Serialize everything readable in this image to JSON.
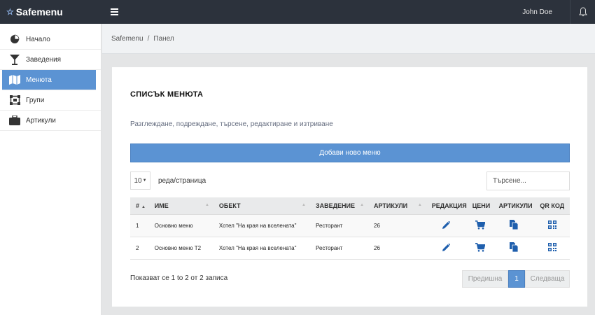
{
  "topbar": {
    "brand": "Safemenu",
    "user": "John Doe"
  },
  "sidebar": {
    "items": [
      {
        "label": "Начало",
        "icon": "pie-chart-icon"
      },
      {
        "label": "Заведения",
        "icon": "cocktail-icon"
      },
      {
        "label": "Менюта",
        "icon": "map-icon"
      },
      {
        "label": "Групи",
        "icon": "group-icon"
      },
      {
        "label": "Артикули",
        "icon": "briefcase-icon"
      }
    ]
  },
  "breadcrumb": {
    "root": "Safemenu",
    "separator": "/",
    "current": "Панел"
  },
  "card": {
    "title": "СПИСЪК МЕНЮТА",
    "subtitle": "Разглеждане, подреждане, търсене, редактиране и изтриване",
    "add_button": "Добави ново меню",
    "page_length": "10",
    "page_length_label": "реда/страница",
    "search_placeholder": "Търсене..."
  },
  "table": {
    "headers": [
      "#",
      "ИМЕ",
      "ОБЕКТ",
      "ЗАВЕДЕНИЕ",
      "АРТИКУЛИ",
      "РЕДАКЦИЯ",
      "ЦЕНИ",
      "АРТИКУЛИ",
      "QR КОД"
    ],
    "rows": [
      {
        "num": "1",
        "name": "Основно меню",
        "object": "Хотел \"На края на вселената\"",
        "venue": "Ресторант",
        "items": "26"
      },
      {
        "num": "2",
        "name": "Основно меню Т2",
        "object": "Хотел \"На края на вселената\"",
        "venue": "Ресторант",
        "items": "26"
      }
    ]
  },
  "footer": {
    "info": "Показват се 1 to 2 от 2 записа",
    "prev": "Предишна",
    "page": "1",
    "next": "Следваща"
  },
  "colors": {
    "accent": "#5b93d3",
    "topbar": "#2c323c",
    "icon_blue": "#1f5fad"
  }
}
